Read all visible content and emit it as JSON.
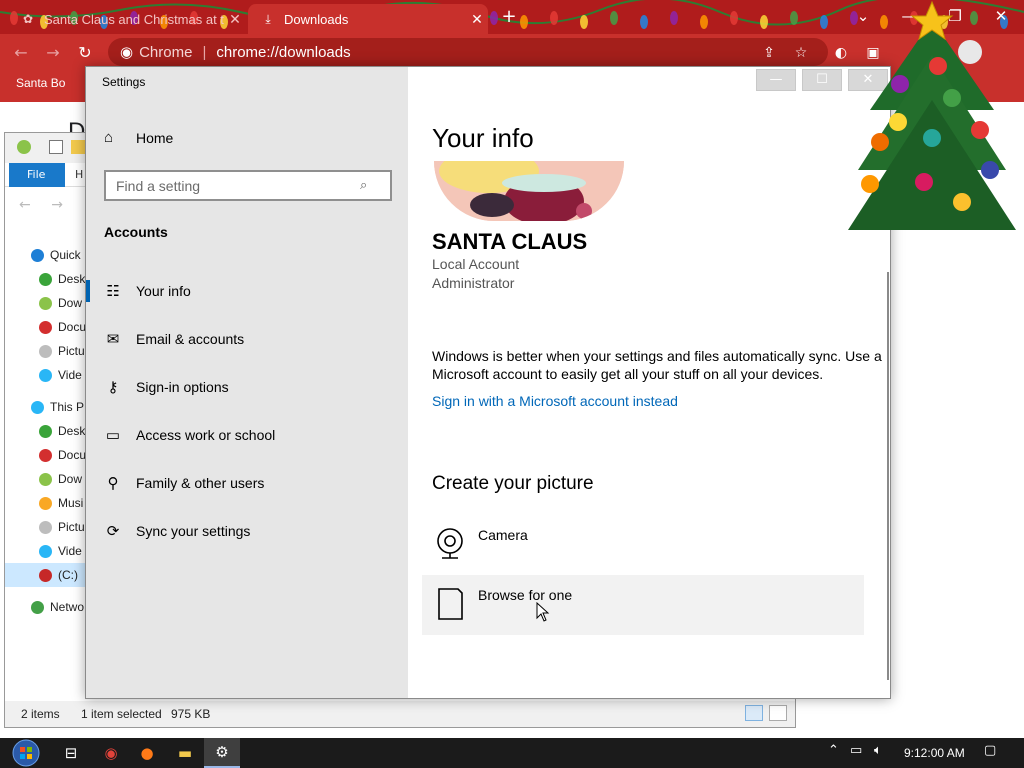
{
  "chrome": {
    "tabs": [
      {
        "title": "Santa Claus and Christmas at th",
        "close": "✕"
      },
      {
        "title": "Downloads",
        "close": "✕"
      }
    ],
    "new_tab": "+",
    "window_controls": {
      "menu": "⌄",
      "minimize": "—",
      "maximize": "❐",
      "close": "✕"
    },
    "omnibox": {
      "site": "Chrome",
      "url": "chrome://downloads"
    },
    "bookmark": "Santa Bo",
    "page_heading": "D"
  },
  "explorer": {
    "file_tab": "File",
    "home_tab": "H",
    "tree": [
      {
        "label": "Quick",
        "color": "#1e7fd6"
      },
      {
        "label": "Desk",
        "color": "#3aa43a"
      },
      {
        "label": "Dow",
        "color": "#8bc34a"
      },
      {
        "label": "Docu",
        "color": "#d32f2f"
      },
      {
        "label": "Pictu",
        "color": "#bdbdbd"
      },
      {
        "label": "Vide",
        "color": "#29b6f6"
      },
      {
        "label": "This P",
        "color": "#29b6f6"
      },
      {
        "label": "Desk",
        "color": "#3aa43a"
      },
      {
        "label": "Docu",
        "color": "#d32f2f"
      },
      {
        "label": "Dow",
        "color": "#8bc34a"
      },
      {
        "label": "Musi",
        "color": "#f9a825"
      },
      {
        "label": "Pictu",
        "color": "#bdbdbd"
      },
      {
        "label": "Vide",
        "color": "#29b6f6"
      },
      {
        "label": "(C:)",
        "color": "#c62828"
      },
      {
        "label": "Netwo",
        "color": "#43a047"
      }
    ],
    "status": {
      "items": "2 items",
      "selected": "1 item selected",
      "size": "975 KB"
    }
  },
  "settings": {
    "app_title": "Settings",
    "home": "Home",
    "search_placeholder": "Find a setting",
    "section": "Accounts",
    "nav_items": [
      {
        "label": "Your info",
        "icon": "person-list-icon"
      },
      {
        "label": "Email & accounts",
        "icon": "mail-icon"
      },
      {
        "label": "Sign-in options",
        "icon": "key-icon"
      },
      {
        "label": "Access work or school",
        "icon": "briefcase-icon"
      },
      {
        "label": "Family & other users",
        "icon": "person-add-icon"
      },
      {
        "label": "Sync your settings",
        "icon": "sync-icon"
      }
    ],
    "content": {
      "title": "Your info",
      "user_name": "SANTA CLAUS",
      "account_type": "Local Account",
      "role": "Administrator",
      "sync_text": "Windows is better when your settings and files automatically sync. Use a Microsoft account to easily get all your stuff on all your devices.",
      "ms_link": "Sign in with a Microsoft account instead",
      "picture_section": "Create your picture",
      "camera": "Camera",
      "browse": "Browse for one"
    },
    "accent": "#0063b1",
    "link_color": "#0067b8"
  },
  "taskbar": {
    "clock": "9:12:00 AM"
  }
}
